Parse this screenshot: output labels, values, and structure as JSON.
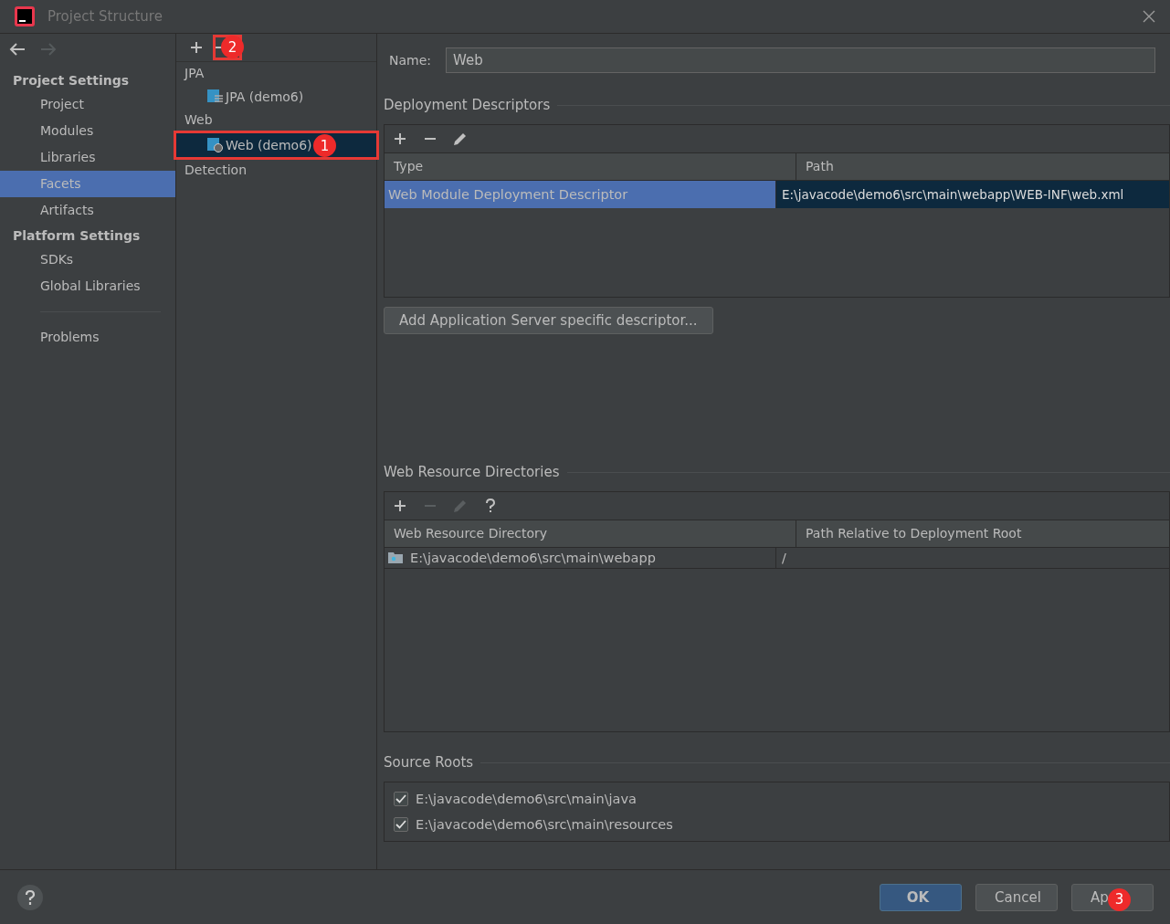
{
  "window": {
    "title": "Project Structure"
  },
  "nav_buttons": [
    {
      "kind": "back",
      "disabled": false
    },
    {
      "kind": "forward",
      "disabled": true
    }
  ],
  "sidebar": {
    "sections": [
      {
        "heading": "Project Settings",
        "items": [
          {
            "label": "Project",
            "selected": false
          },
          {
            "label": "Modules",
            "selected": false
          },
          {
            "label": "Libraries",
            "selected": false
          },
          {
            "label": "Facets",
            "selected": true
          },
          {
            "label": "Artifacts",
            "selected": false
          }
        ]
      },
      {
        "heading": "Platform Settings",
        "items": [
          {
            "label": "SDKs",
            "selected": false
          },
          {
            "label": "Global Libraries",
            "selected": false
          }
        ]
      }
    ],
    "extra_items": [
      {
        "label": "Problems",
        "selected": false
      }
    ]
  },
  "facets_toolbar": [
    {
      "kind": "add",
      "disabled": false
    },
    {
      "kind": "remove",
      "disabled": false,
      "marker": {
        "number": "2",
        "boxed": true
      }
    }
  ],
  "facets_tree": [
    {
      "label": "JPA",
      "children": [
        {
          "label": "JPA (demo6)",
          "kind": "jpa",
          "selected": false
        }
      ]
    },
    {
      "label": "Web",
      "children": [
        {
          "label": "Web (demo6)",
          "kind": "web",
          "selected": true,
          "marker": {
            "number": "1",
            "boxed": true
          }
        }
      ]
    },
    {
      "label": "Detection"
    }
  ],
  "name_field": {
    "label": "Name:",
    "value": "Web"
  },
  "deployment_descriptors": {
    "title": "Deployment Descriptors",
    "toolbar": [
      {
        "kind": "add",
        "disabled": false
      },
      {
        "kind": "remove",
        "disabled": false
      },
      {
        "kind": "edit",
        "disabled": false
      }
    ],
    "columns": [
      "Type",
      "Path"
    ],
    "rows": [
      {
        "cells": [
          "Web Module Deployment Descriptor",
          "E:\\javacode\\demo6\\src\\main\\webapp\\WEB-INF\\web.xml"
        ],
        "selected": true
      }
    ],
    "button": "Add Application Server specific descriptor..."
  },
  "web_resource_directories": {
    "title": "Web Resource Directories",
    "toolbar": [
      {
        "kind": "add",
        "disabled": false
      },
      {
        "kind": "remove",
        "disabled": true
      },
      {
        "kind": "edit",
        "disabled": true
      },
      {
        "kind": "help",
        "disabled": false
      }
    ],
    "columns": [
      "Web Resource Directory",
      "Path Relative to Deployment Root"
    ],
    "rows": [
      {
        "cells": [
          "E:\\javacode\\demo6\\src\\main\\webapp",
          "/"
        ],
        "selected": false
      }
    ]
  },
  "source_roots": {
    "title": "Source Roots",
    "items": [
      {
        "label": "E:\\javacode\\demo6\\src\\main\\java",
        "checked": true
      },
      {
        "label": "E:\\javacode\\demo6\\src\\main\\resources",
        "checked": true
      }
    ]
  },
  "footer": {
    "buttons": [
      {
        "label": "OK",
        "kind": "default"
      },
      {
        "label": "Cancel",
        "kind": "normal"
      },
      {
        "label": "Ap",
        "kind": "normal",
        "marker": {
          "number": "3",
          "boxed": false
        }
      }
    ]
  }
}
